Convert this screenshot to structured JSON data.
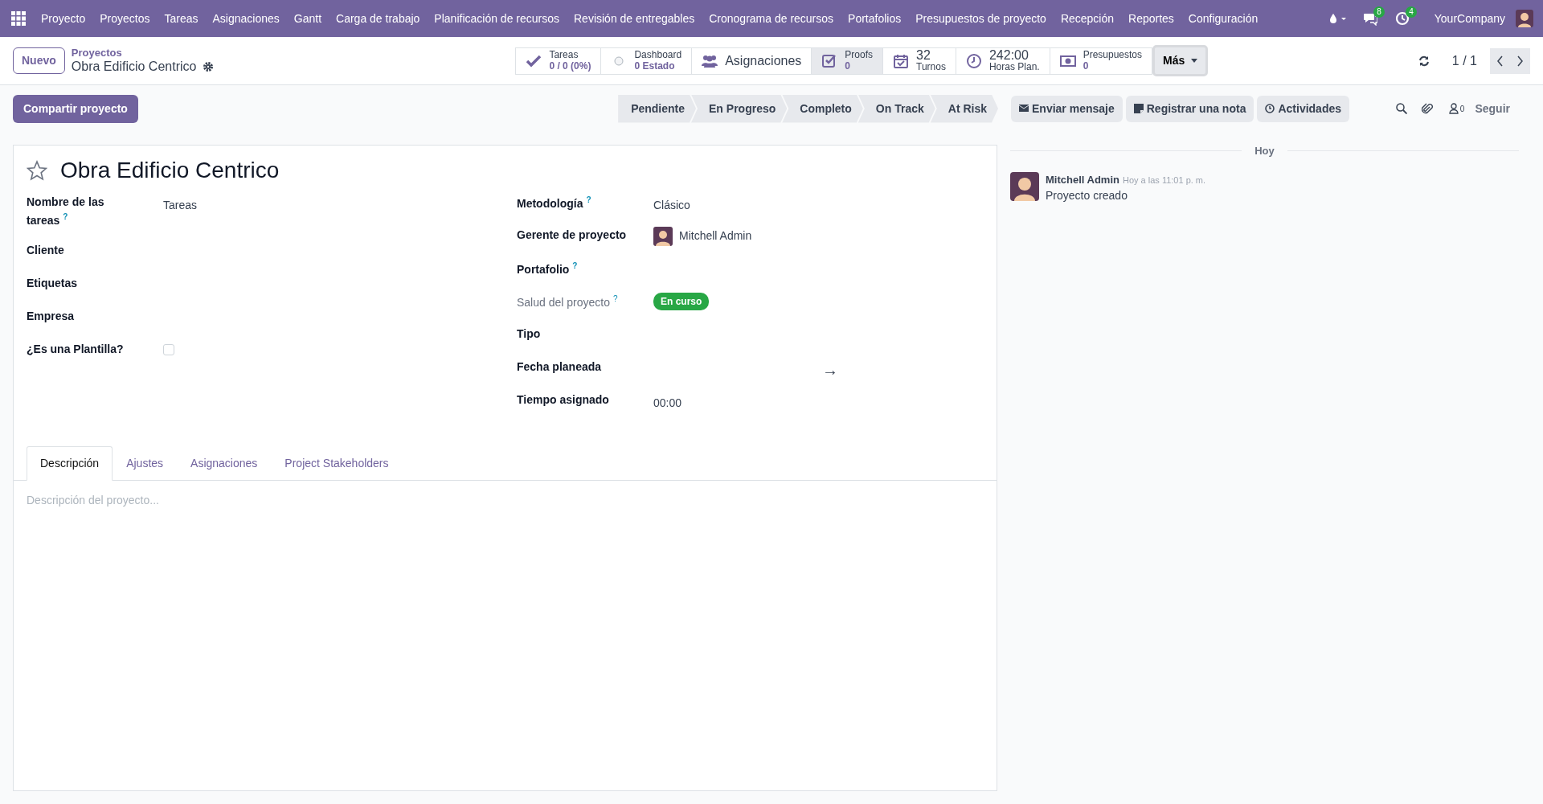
{
  "navbar": {
    "app": "Proyecto",
    "menu": [
      "Proyectos",
      "Tareas",
      "Asignaciones",
      "Gantt",
      "Carga de trabajo",
      "Planificación de recursos",
      "Revisión de entregables",
      "Cronograma de recursos",
      "Portafolios",
      "Presupuestos de proyecto",
      "Recepción",
      "Reportes",
      "Configuración"
    ],
    "badges": [
      {
        "kind": "chat",
        "count": "8"
      },
      {
        "kind": "activity",
        "count": "4"
      }
    ],
    "company": "YourCompany"
  },
  "control_panel": {
    "new_button": "Nuevo",
    "breadcrumb": "Proyectos",
    "record": "Obra Edificio Centrico",
    "smart_buttons": [
      {
        "kind": "stat",
        "title": "Tareas",
        "value": "0 / 0 (0%)",
        "hovered": false
      },
      {
        "kind": "stat",
        "title": "Dashboard",
        "value": "0 Estado",
        "hovered": false
      },
      {
        "kind": "label",
        "title": "Asignaciones",
        "hovered": false
      },
      {
        "kind": "stat",
        "title": "Proofs",
        "value": "0",
        "hovered": true
      },
      {
        "kind": "count",
        "value": "32",
        "title": "Turnos",
        "hovered": false
      },
      {
        "kind": "count",
        "value": "242:00",
        "title": "Horas Plan.",
        "hovered": false
      },
      {
        "kind": "stat",
        "title": "Presupuestos",
        "value": "0",
        "hovered": false
      }
    ],
    "more": "Más",
    "pager": "1 / 1"
  },
  "actions": {
    "share_button": "Compartir proyecto",
    "stages": [
      {
        "label": "Pendiente",
        "selected": false
      },
      {
        "label": "En Progreso",
        "selected": false
      },
      {
        "label": "Completo",
        "selected": false
      },
      {
        "label": "On Track",
        "selected": false
      },
      {
        "label": "At Risk",
        "selected": false
      }
    ]
  },
  "chatter_bar": {
    "buttons": [
      {
        "kind": "mail",
        "label": "Enviar mensaje"
      },
      {
        "kind": "note",
        "label": "Registrar una nota"
      },
      {
        "kind": "activity",
        "label": "Actividades"
      }
    ],
    "followers": "0",
    "follow": "Seguir"
  },
  "form": {
    "title": "Obra Edificio Centrico",
    "starred": false,
    "left_fields": [
      {
        "kind": "text",
        "label": "Nombre de las tareas",
        "help": "?",
        "value": "Tareas"
      },
      {
        "kind": "text",
        "label": "Cliente"
      },
      {
        "kind": "text",
        "label": "Etiquetas"
      },
      {
        "kind": "text",
        "label": "Empresa"
      },
      {
        "kind": "checkbox",
        "label": "¿Es una Plantilla?",
        "checked": false
      }
    ],
    "right_fields": [
      {
        "kind": "text",
        "label": "Metodología",
        "help": "?",
        "value": "Clásico"
      },
      {
        "kind": "user",
        "label": "Gerente de proyecto",
        "value": "Mitchell Admin"
      },
      {
        "kind": "text",
        "label": "Portafolio",
        "help": "?"
      },
      {
        "kind": "badge",
        "label": "Salud del proyecto",
        "help": "?",
        "muted": true,
        "value": "En curso",
        "color": "#28a745"
      },
      {
        "kind": "text",
        "label": "Tipo"
      },
      {
        "kind": "daterange",
        "label": "Fecha planeada",
        "value": "→"
      },
      {
        "kind": "text",
        "label": "Tiempo asignado",
        "value": "00:00"
      }
    ],
    "tabs": [
      {
        "label": "Descripción",
        "selected": true
      },
      {
        "label": "Ajustes",
        "selected": false
      },
      {
        "label": "Asignaciones",
        "selected": false
      },
      {
        "label": "Project Stakeholders",
        "selected": false
      }
    ],
    "description": {
      "placeholder": "Descripción del proyecto..."
    }
  },
  "chatter": {
    "date_separator": "Hoy",
    "messages": [
      {
        "author": "Mitchell Admin",
        "time": "Hoy a las 11:01 p. m.",
        "body": "Proyecto creado"
      }
    ]
  }
}
